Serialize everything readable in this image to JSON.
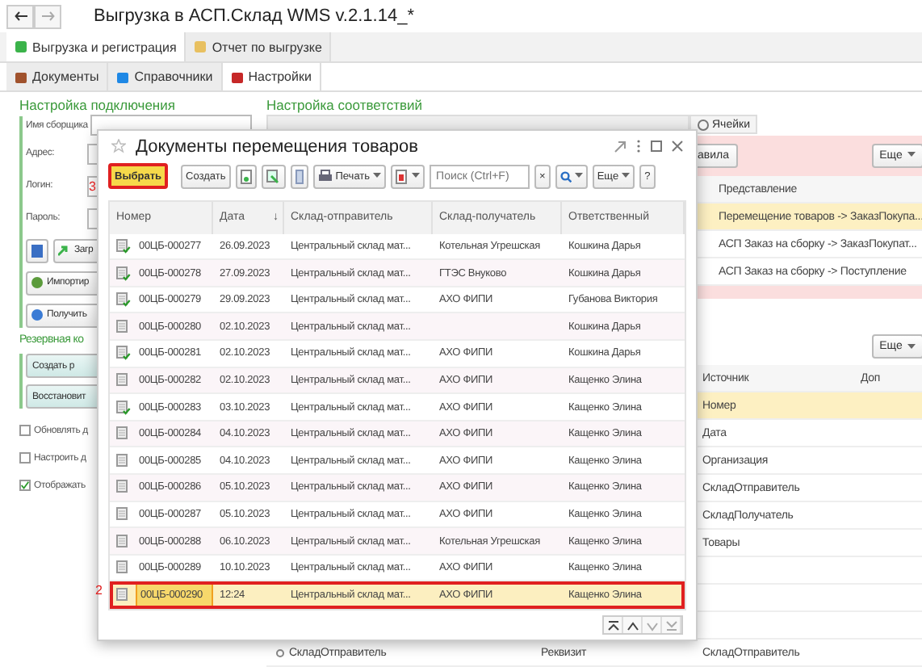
{
  "window": {
    "title": "Выгрузка в АСП.Склад WMS v.2.1.14_*"
  },
  "main_tabs": [
    {
      "label": "Выгрузка и регистрация",
      "selected": true
    },
    {
      "label": "Отчет по выгрузке",
      "selected": false
    }
  ],
  "section_tabs": [
    {
      "label": "Документы",
      "selected": false
    },
    {
      "label": "Справочники",
      "selected": false
    },
    {
      "label": "Настройки",
      "selected": true
    }
  ],
  "connection": {
    "title": "Настройка подключения",
    "fields": [
      {
        "label": "Имя сборщика"
      },
      {
        "label": "Адрес:"
      },
      {
        "label": "Логин:"
      },
      {
        "label": "Пароль:"
      }
    ],
    "buttons": [
      "Загр",
      "Импортир",
      "Получить"
    ]
  },
  "backup": {
    "title": "Резервная ко",
    "buttons": [
      "Создать р",
      "Восстановит"
    ]
  },
  "options": [
    {
      "label": "Обновлять д",
      "checked": false
    },
    {
      "label": "Настроить д",
      "checked": false
    },
    {
      "label": "Отображать",
      "checked": true
    }
  ],
  "mapping": {
    "title": "Настройка соответствий",
    "tabs": [
      {
        "label": "Ячейки",
        "selected": false
      }
    ],
    "rules_button": "авила",
    "more_button": "Еще",
    "rules_header": "Представление",
    "rules": [
      {
        "text": "Перемещение товаров -> ЗаказПокупа...",
        "selected": true
      },
      {
        "text": "АСП Заказ на сборку -> ЗаказПокупат...",
        "selected": false
      },
      {
        "text": "АСП Заказ на сборку -> Поступление",
        "selected": false
      }
    ],
    "more_button_2": "Еще",
    "source_columns": [
      "Источник",
      "Доп"
    ],
    "sources": [
      {
        "text": "Номер",
        "selected": true
      },
      {
        "text": "Дата",
        "selected": false
      },
      {
        "text": "Организация",
        "selected": false
      },
      {
        "text": "СкладОтправитель",
        "selected": false
      },
      {
        "text": "СкладПолучатель",
        "selected": false
      },
      {
        "text": "Товары",
        "selected": false
      }
    ],
    "bottom_row": [
      "СкладОтправитель",
      "Реквизит",
      "СкладОтправитель"
    ]
  },
  "dialog": {
    "title": "Документы перемещения товаров",
    "select_button": "Выбрать",
    "create_button": "Создать",
    "print_button": "Печать",
    "search": {
      "placeholder": "Поиск (Ctrl+F)"
    },
    "clear": "×",
    "more_button": "Еще",
    "help_button": "?",
    "marker_select": "3",
    "marker_row": "2",
    "columns": [
      "Номер",
      "Дата",
      "↓",
      "Склад-отправитель",
      "Склад-получатель",
      "Ответственный"
    ],
    "rows": [
      {
        "number": "00ЦБ-000277",
        "date": "26.09.2023",
        "sender": "Центральный склад мат...",
        "receiver": "Котельная Угрешская",
        "responsible": "Кошкина Дарья",
        "posted": true,
        "selected": false
      },
      {
        "number": "00ЦБ-000278",
        "date": "27.09.2023",
        "sender": "Центральный склад мат...",
        "receiver": "ГТЭС Внуково",
        "responsible": "Кошкина Дарья",
        "posted": true,
        "selected": false
      },
      {
        "number": "00ЦБ-000279",
        "date": "29.09.2023",
        "sender": "Центральный склад мат...",
        "receiver": "АХО ФИПИ",
        "responsible": "Губанова Виктория",
        "posted": true,
        "selected": false
      },
      {
        "number": "00ЦБ-000280",
        "date": "02.10.2023",
        "sender": "Центральный склад мат...",
        "receiver": "",
        "responsible": "Кошкина Дарья",
        "posted": false,
        "selected": false
      },
      {
        "number": "00ЦБ-000281",
        "date": "02.10.2023",
        "sender": "Центральный склад мат...",
        "receiver": "АХО ФИПИ",
        "responsible": "Кошкина Дарья",
        "posted": true,
        "selected": false
      },
      {
        "number": "00ЦБ-000282",
        "date": "02.10.2023",
        "sender": "Центральный склад мат...",
        "receiver": "АХО ФИПИ",
        "responsible": "Кащенко Элина",
        "posted": false,
        "selected": false
      },
      {
        "number": "00ЦБ-000283",
        "date": "03.10.2023",
        "sender": "Центральный склад мат...",
        "receiver": "АХО ФИПИ",
        "responsible": "Кащенко Элина",
        "posted": true,
        "selected": false
      },
      {
        "number": "00ЦБ-000284",
        "date": "04.10.2023",
        "sender": "Центральный склад мат...",
        "receiver": "АХО ФИПИ",
        "responsible": "Кащенко Элина",
        "posted": false,
        "selected": false
      },
      {
        "number": "00ЦБ-000285",
        "date": "04.10.2023",
        "sender": "Центральный склад мат...",
        "receiver": "АХО ФИПИ",
        "responsible": "Кащенко Элина",
        "posted": false,
        "selected": false
      },
      {
        "number": "00ЦБ-000286",
        "date": "05.10.2023",
        "sender": "Центральный склад мат...",
        "receiver": "АХО ФИПИ",
        "responsible": "Кащенко Элина",
        "posted": false,
        "selected": false
      },
      {
        "number": "00ЦБ-000287",
        "date": "05.10.2023",
        "sender": "Центральный склад мат...",
        "receiver": "АХО ФИПИ",
        "responsible": "Кащенко Элина",
        "posted": false,
        "selected": false
      },
      {
        "number": "00ЦБ-000288",
        "date": "06.10.2023",
        "sender": "Центральный склад мат...",
        "receiver": "Котельная Угрешская",
        "responsible": "Кащенко Элина",
        "posted": false,
        "selected": false
      },
      {
        "number": "00ЦБ-000289",
        "date": "10.10.2023",
        "sender": "Центральный склад мат...",
        "receiver": "АХО ФИПИ",
        "responsible": "Кащенко Элина",
        "posted": false,
        "selected": false
      },
      {
        "number": "00ЦБ-000290",
        "date": "12:24",
        "sender": "Центральный склад мат...",
        "receiver": "АХО ФИПИ",
        "responsible": "Кащенко Элина",
        "posted": false,
        "selected": true
      }
    ]
  }
}
